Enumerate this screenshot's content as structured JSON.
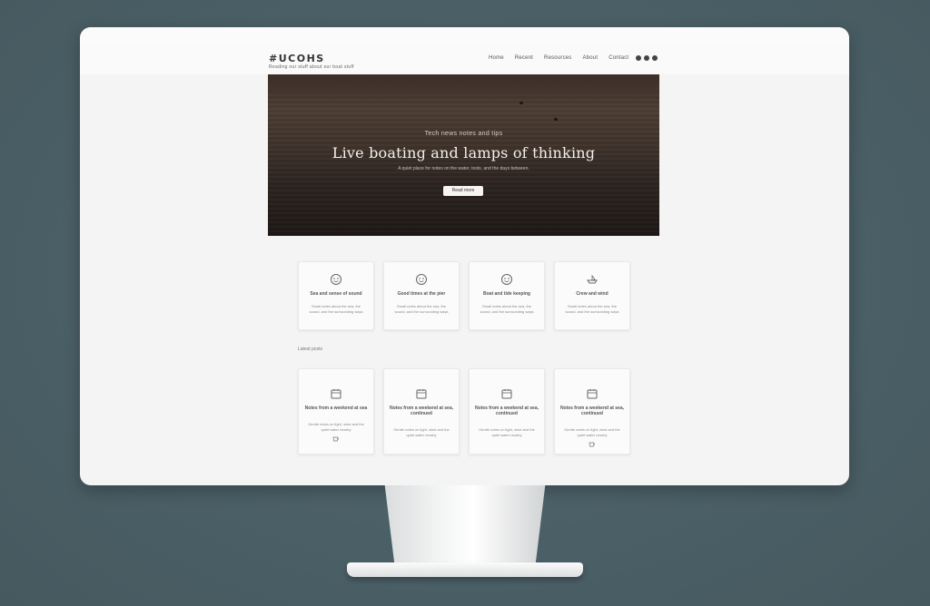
{
  "site": {
    "logo": "#UCOHS",
    "tagline": "Reading our stuff about our boat stuff"
  },
  "nav": {
    "items": [
      "Home",
      "Recent",
      "Resources",
      "About",
      "Contact"
    ]
  },
  "hero": {
    "eyebrow": "Tech news notes and tips",
    "title": "Live boating and lamps of thinking",
    "subtitle": "A quiet place for notes on the water, tools, and the days between.",
    "button": "Read more"
  },
  "features": [
    {
      "icon": "face-icon",
      "title": "Sea and sense of sound",
      "desc": "Small notes about the sea, the sound, and the surrounding ways"
    },
    {
      "icon": "face-icon",
      "title": "Good times at the pier",
      "desc": "Small notes about the sea, the sound, and the surrounding ways"
    },
    {
      "icon": "face-icon",
      "title": "Boat and tide keeping",
      "desc": "Small notes about the sea, the sound, and the surrounding ways"
    },
    {
      "icon": "boat-icon",
      "title": "Crew and wind",
      "desc": "Small notes about the sea, the sound, and the surrounding ways"
    }
  ],
  "section_label": "Latest posts",
  "posts": [
    {
      "icon": "calendar-icon",
      "title": "Notes from a weekend at sea",
      "desc": "Gentle notes on light, wind and the quiet water nearby"
    },
    {
      "icon": "calendar-icon",
      "title": "Notes from a weekend at sea, continued",
      "desc": "Gentle notes on light, wind and the quiet water nearby"
    },
    {
      "icon": "calendar-icon",
      "title": "Notes from a weekend at sea, continued",
      "desc": "Gentle notes on light, wind and the quiet water nearby"
    },
    {
      "icon": "calendar-icon",
      "title": "Notes from a weekend at sea, continued",
      "desc": "Gentle notes on light, wind and the quiet water nearby"
    }
  ]
}
